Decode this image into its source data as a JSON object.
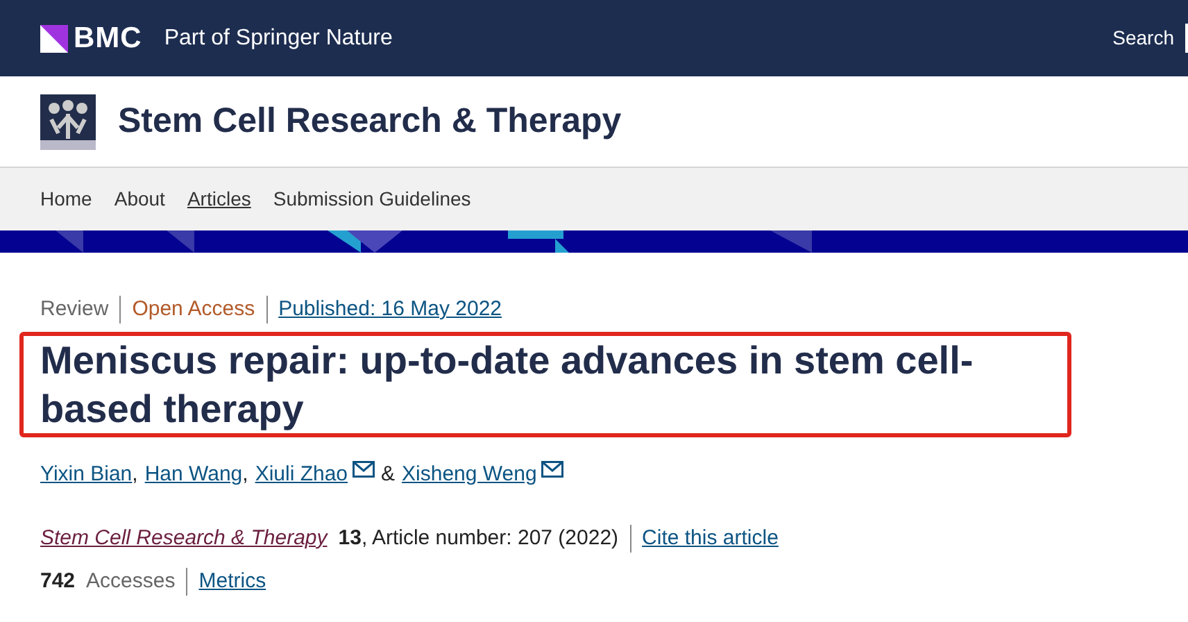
{
  "topbar": {
    "brand": "BMC",
    "tagline": "Part of Springer Nature",
    "search": "Search"
  },
  "journal": {
    "title": "Stem Cell Research & Therapy"
  },
  "nav": [
    {
      "label": "Home",
      "selected": false
    },
    {
      "label": "About",
      "selected": false
    },
    {
      "label": "Articles",
      "selected": true
    },
    {
      "label": "Submission Guidelines",
      "selected": false
    }
  ],
  "article": {
    "type": "Review",
    "access": "Open Access",
    "published": "Published: 16 May 2022",
    "title": "Meniscus repair: up-to-date advances in stem cell-based therapy",
    "highlighted": true,
    "authors": [
      {
        "name": "Yixin Bian",
        "mail": false,
        "joiner": ","
      },
      {
        "name": "Han Wang",
        "mail": false,
        "joiner": ","
      },
      {
        "name": "Xiuli Zhao",
        "mail": true,
        "joiner": "&"
      },
      {
        "name": "Xisheng Weng",
        "mail": true
      }
    ],
    "citation": {
      "journal": "Stem Cell Research & Therapy",
      "details": "**13**, Article number: 207 (2022)",
      "cite": "Cite this article"
    },
    "metrics": {
      "count": "742",
      "label": "Accesses",
      "link": "Metrics"
    }
  }
}
